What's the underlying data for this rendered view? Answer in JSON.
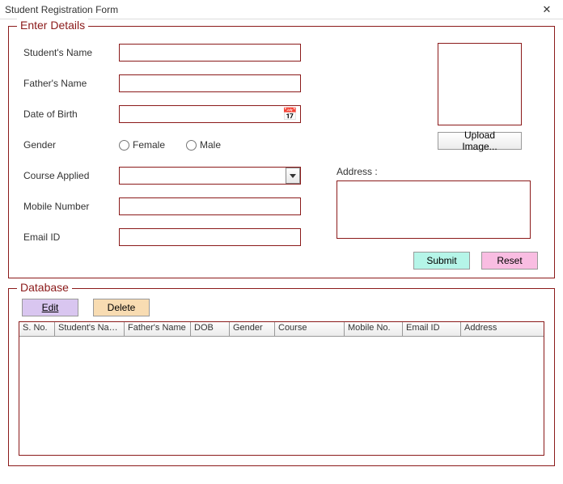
{
  "window": {
    "title": "Student Registration Form",
    "close": "✕"
  },
  "groups": {
    "enter_details": "Enter Details",
    "database": "Database"
  },
  "labels": {
    "student_name": "Student's Name",
    "father_name": "Father's Name",
    "dob": "Date of Birth",
    "gender": "Gender",
    "course": "Course Applied",
    "mobile": "Mobile Number",
    "email": "Email ID",
    "address": "Address :"
  },
  "values": {
    "student_name": "",
    "father_name": "",
    "dob": "",
    "course": "",
    "mobile": "",
    "email": "",
    "address": ""
  },
  "gender_options": {
    "female": "Female",
    "male": "Male"
  },
  "buttons": {
    "upload": "Upload Image...",
    "submit": "Submit",
    "reset": "Reset",
    "edit": "Edit",
    "delete": "Delete"
  },
  "grid_headers": {
    "sno": "S. No.",
    "sname": "Student's Name",
    "fname": "Father's Name",
    "dob": "DOB",
    "gender": "Gender",
    "course": "Course",
    "mobile": "Mobile No.",
    "email": "Email ID",
    "address": "Address"
  },
  "colors": {
    "border": "#8b1a1a",
    "submit_bg": "#b5f5e8",
    "reset_bg": "#f9bde2",
    "edit_bg": "#d9c6f0",
    "delete_bg": "#f8dcb2"
  }
}
